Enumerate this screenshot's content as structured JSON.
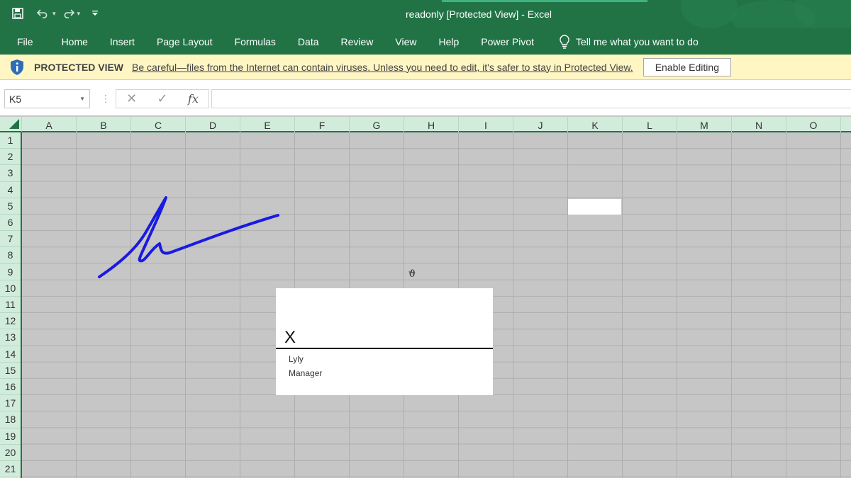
{
  "window": {
    "title": "readonly  [Protected View]  -  Excel"
  },
  "ribbon": {
    "tabs": [
      "File",
      "Home",
      "Insert",
      "Page Layout",
      "Formulas",
      "Data",
      "Review",
      "View",
      "Help",
      "Power Pivot"
    ],
    "tell_me": "Tell me what you want to do"
  },
  "protected_view": {
    "title": "PROTECTED VIEW",
    "message": "Be careful—files from the Internet can contain viruses. Unless you need to edit, it's safer to stay in Protected View.",
    "button": "Enable Editing"
  },
  "formula_bar": {
    "name_box": "K5",
    "fx": "fx",
    "formula": ""
  },
  "grid": {
    "columns": [
      "A",
      "B",
      "C",
      "D",
      "E",
      "F",
      "G",
      "H",
      "I",
      "J",
      "K",
      "L",
      "M",
      "N",
      "O"
    ],
    "rows": [
      "1",
      "2",
      "3",
      "4",
      "5",
      "6",
      "7",
      "8",
      "9",
      "10",
      "11",
      "12",
      "13",
      "14",
      "15",
      "16",
      "17",
      "18",
      "19",
      "20",
      "21"
    ],
    "selected_cell": "K5"
  },
  "signature_line": {
    "mark": "X",
    "signer": "Lyly",
    "role": "Manager"
  },
  "colors": {
    "excel_green": "#217346",
    "warning_bg": "#fff6c4",
    "signature_ink": "#1a1ae0"
  }
}
